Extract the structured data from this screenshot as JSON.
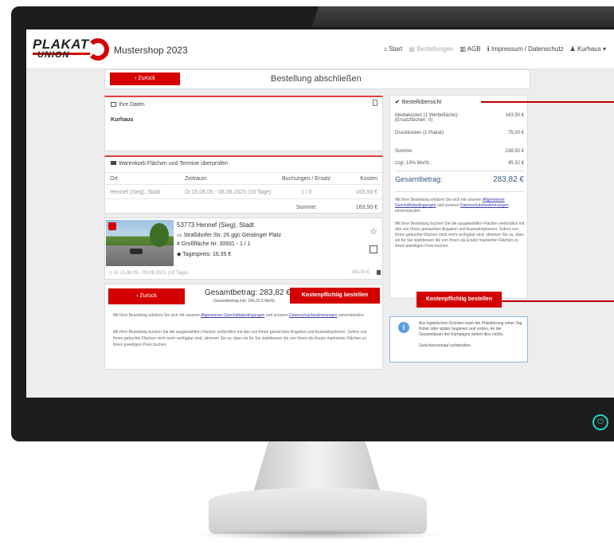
{
  "app": {
    "logo_line1": "PLAKAT",
    "logo_line2": "UNION",
    "shop_title": "Mustershop 2023",
    "accent_color": "#d40000"
  },
  "nav": {
    "start": "Start",
    "orders": "Bestellungen",
    "agb": "AGB",
    "imprint": "Impressum / Datenschutz",
    "user": "Kurhaus"
  },
  "header": {
    "back_label": "‹ Zurück",
    "page_title": "Bestellung abschließen"
  },
  "daten": {
    "label": "Ihre Daten",
    "customer": "Kurhaus"
  },
  "table": {
    "section_label": "Warenkorb Flächen und Termine überprüfen",
    "headers": [
      "Ort",
      "Zeitraum",
      "Buchungen / Ersatz",
      "Kosten"
    ],
    "row": [
      "Hennef (Sieg), Stadt",
      "Di 15.08.05 - 08.08.2023 (10 Tage)",
      "1 / 0",
      "163,50 €"
    ],
    "sum_label": "Summe:",
    "sum_value": "163,50 €"
  },
  "location": {
    "city": "53773 Hennef (Sieg), Stadt",
    "street": "Straßdorfer Str. 26 ggü Geistinger Platz",
    "area": "Großfläche Nr. 30931 - 1 / 1",
    "price": "Tagespreis: 16,35 €",
    "period": "Di 15.08.05 - 09.08.2023 (10 Tage)",
    "cost": "163,50 €"
  },
  "total": {
    "back_label": "‹ Zurück",
    "total_label": "Gesamtbetrag: 283,82 €",
    "total_sub": "Gesamtbetrag inkl. 245,32 € MwSt.",
    "order_label": "Kostenpflichtig bestellen",
    "fine1_a": "Mit Ihrer Bestellung erklären Sie sich mit unseren",
    "fine1_link1": "Allgemeinen Geschäftsbedingungen",
    "fine1_b": "und unseren",
    "fine1_link2": "Datenschutzbestimmungen",
    "fine1_c": "einverstanden.",
    "fine2": "Mit Ihrer Bestellung buchen Sie die ausgewählten Flächen verbindlich mit den von Ihnen gemachten Angaben und Auswahloptionen. Sofern von Ihnen gebuchte Flächen nicht mehr verfügbar sind, stimmen Sie zu, dass wir für Sie stattdessen die von Ihnen als Ersatz markierten Flächen zu ihrem jeweiligen Preis buchen."
  },
  "summary": {
    "title": "Bestellübersicht",
    "rows": [
      {
        "label": "Mediakosten (1 Werbefläche):",
        "sub": "(Ersatzflächen: 0)",
        "value": "163,50 €"
      },
      {
        "label": "Druckkosten (1 Plakat):",
        "sub": "",
        "value": "75,00 €"
      },
      {
        "label": "Summe:",
        "sub": "",
        "value": "238,50 €"
      },
      {
        "label": "zzgl. 19% MwSt.:",
        "sub": "",
        "value": "45,32 €"
      }
    ],
    "total_label": "Gesamtbetrag:",
    "total_value": "283,82 €",
    "fine1_a": "Mit Ihrer Bestellung erklären Sie sich mit unseren",
    "fine1_link1": "Allgemeinen Geschäftsbedingungen",
    "fine1_b": "und unseren",
    "fine1_link2": "Datenschutzbestimmungen",
    "fine1_c": "einverstanden.",
    "fine2": "Mit Ihrer Bestellung buchen Sie die ausgewählten Flächen verbindlich mit den von Ihnen gemachten Angaben und Auswahloptionen. Sofern von Ihnen gebuchte Flächen nicht mehr verfügbar sind, stimmen Sie zu, dass wir für Sie stattdessen die von Ihnen als Ersatz markierten Flächen zu ihrem jeweiligen Preis buchen.",
    "order_label": "Kostenpflichtig bestellen"
  },
  "info": {
    "text1": "Aus logistischen Gründen kann die Plakatierung einen Tag früher oder später beginnen und enden. An der Gesamtdauer der Kampagne ändert dies nichts.",
    "text2": "Zwischenverkauf vorbehalten."
  }
}
